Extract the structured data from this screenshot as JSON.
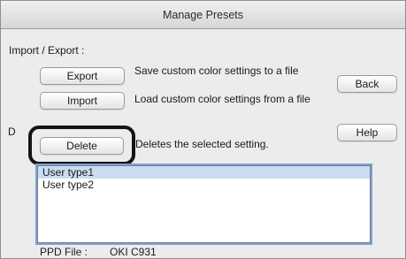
{
  "window": {
    "title": "Manage Presets"
  },
  "import_export": {
    "section_label": "Import / Export :",
    "export_button": "Export",
    "export_description": "Save custom color settings to a file",
    "import_button": "Import",
    "import_description": "Load custom color settings from a file"
  },
  "side_buttons": {
    "back": "Back",
    "help": "Help"
  },
  "delete_section": {
    "label_partial": "D",
    "delete_button": "Delete",
    "delete_description": "Deletes the selected setting."
  },
  "presets_list": {
    "items": [
      {
        "label": "User type1",
        "selected": true
      },
      {
        "label": "User type2",
        "selected": false
      }
    ]
  },
  "footer": {
    "ppd_label": "PPD File :",
    "ppd_value": "OKI C931"
  },
  "colors": {
    "selection": "#c9dcf2",
    "focus_ring": "#7aa1d6",
    "annotation_ring": "#141414"
  }
}
